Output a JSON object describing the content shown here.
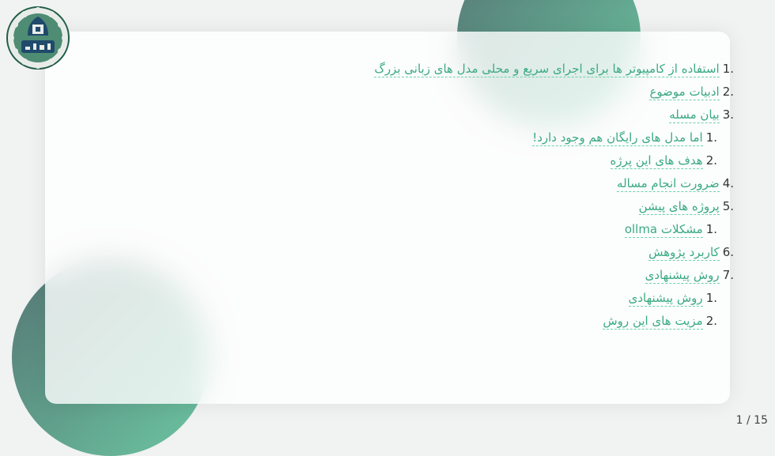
{
  "logo": {
    "name": "university-of-isfahan-logo"
  },
  "toc": {
    "items": [
      {
        "number": "1.",
        "label": "استفاده از کامپیوتر ها برای اجرای سریع و محلی مدل های زبانی بزرگ",
        "level": 1
      },
      {
        "number": "2.",
        "label": "ادبیات موضوع",
        "level": 1
      },
      {
        "number": "3.",
        "label": "بیان مسله",
        "level": 1
      },
      {
        "number": "1.",
        "label": "اما مدل های رایگان هم وجود دارد!",
        "level": 2
      },
      {
        "number": "2.",
        "label": "هدف های این پرژه",
        "level": 2
      },
      {
        "number": "4.",
        "label": "ضرورت انجام مساله",
        "level": 1
      },
      {
        "number": "5.",
        "label": "پروژه های پیشن",
        "level": 1
      },
      {
        "number": "1.",
        "label": "مشکلات ollma",
        "level": 2
      },
      {
        "number": "6.",
        "label": "کاربرد پژوهش",
        "level": 1
      },
      {
        "number": "7.",
        "label": "روش پیشنهادی",
        "level": 1
      },
      {
        "number": "1.",
        "label": "روش پیشنهادی",
        "level": 2
      },
      {
        "number": "2.",
        "label": "مزیت های این روش",
        "level": 2
      }
    ]
  },
  "pager": {
    "text": "1 / 15"
  },
  "colors": {
    "link": "#3aaa82",
    "link_underline": "#6fd0ab",
    "blob_dark": "#567675",
    "blob_light": "#6cc6a3"
  }
}
